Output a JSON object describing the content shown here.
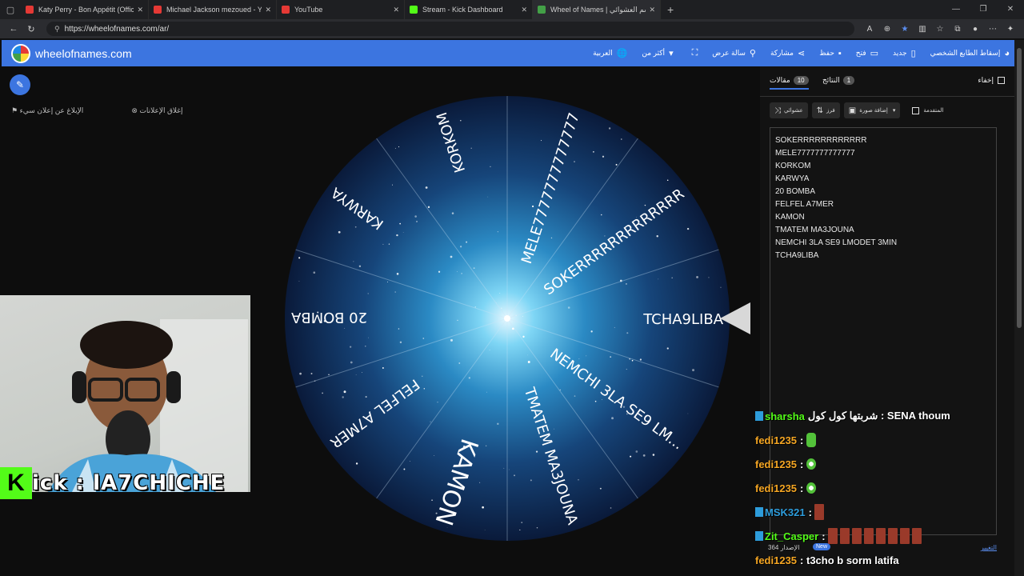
{
  "browser": {
    "tabs": [
      {
        "label": "Katy Perry - Bon Appétit (Official",
        "favicon_color": "#e53935",
        "active": false
      },
      {
        "label": "Michael Jackson mezoued - YouT",
        "favicon_color": "#e53935",
        "active": false
      },
      {
        "label": "YouTube",
        "favicon_color": "#e53935",
        "active": false
      },
      {
        "label": "Stream - Kick Dashboard",
        "favicon_color": "#53fc18",
        "active": false
      },
      {
        "label": "Wheel of Names | الاسم العشوائي",
        "favicon_color": "#43a047",
        "active": true
      }
    ],
    "url": "https://wheelofnames.com/ar/"
  },
  "app": {
    "site_name": "wheelofnames.com",
    "menu": [
      {
        "label": "العربية",
        "icon": "globe-icon"
      },
      {
        "label": "أكثر من",
        "icon": "chevron-down-icon"
      },
      {
        "label": "",
        "icon": "fullscreen-icon"
      },
      {
        "label": "سالة عرض",
        "icon": "search-icon"
      },
      {
        "label": "مشاركة",
        "icon": "share-icon"
      },
      {
        "label": "حفظ",
        "icon": "save-icon"
      },
      {
        "label": "فتح",
        "icon": "folder-icon"
      },
      {
        "label": "جديد",
        "icon": "file-icon"
      },
      {
        "label": "إسقاط الطابع الشخصي",
        "icon": "palette-icon"
      }
    ],
    "accent": "#3c75e0"
  },
  "stage": {
    "ad_close": "إغلاق الإعلانات",
    "ad_report": "الإبلاغ عن إعلان سيء"
  },
  "wheel": {
    "segments": [
      "SOKERRRRRRRRRRRRR",
      "MELE7777777777777",
      "KORKOM",
      "KARWYA",
      "20 BOMBA",
      "FELFEL A7MER",
      "KAMON",
      "TMATEM MA3JOUNA",
      "NEMCHI 3LA SE9 LM...",
      "TCHA9LIBA"
    ]
  },
  "stream": {
    "kick_name": "ick : lA7CHICHE"
  },
  "panel": {
    "tab_entries_label": "مقالات",
    "tab_entries_count": "10",
    "tab_results_label": "النتائج",
    "tab_results_count": "1",
    "hide_label": "إخفاء",
    "shuffle_label": "عشوائي",
    "sort_label": "فرز",
    "add_image_label": "إضافة صورة",
    "advanced_label": "المتقدمة",
    "entries": [
      "SOKERRRRRRRRRRRR",
      "MELE7777777777777",
      "KORKOM",
      "KARWYA",
      "20 BOMBA",
      "FELFEL A7MER",
      "KAMON",
      "TMATEM MA3JOUNA",
      "NEMCHI 3LA SE9 LMODET 3MIN",
      "TCHA9LIBA"
    ],
    "footer_count": "364",
    "footer_label": "الإصدار",
    "footer_new": "New",
    "footer_change": "التغيير"
  },
  "chat": [
    {
      "user": "sharsha",
      "user_color": "#53fc18",
      "text": "شربتها كول كول : SENA thoum",
      "emotes": 0
    },
    {
      "user": "fedi1235",
      "user_color": "#f5a623",
      "text": ":",
      "emotes": 1
    },
    {
      "user": "fedi1235",
      "user_color": "#f5a623",
      "text": ":",
      "emotes": 1
    },
    {
      "user": "fedi1235",
      "user_color": "#f5a623",
      "text": ":",
      "emotes": 1
    },
    {
      "user": "MSK321",
      "user_color": "#2d9cdb",
      "text": ":",
      "emotes": 1
    },
    {
      "user": "Zit_Casper",
      "user_color": "#53fc18",
      "text": ":",
      "emotes": 8
    },
    {
      "user": "fedi1235",
      "user_color": "#f5a623",
      "text": ": t3cho b sorm latifa",
      "emotes": 0
    }
  ]
}
